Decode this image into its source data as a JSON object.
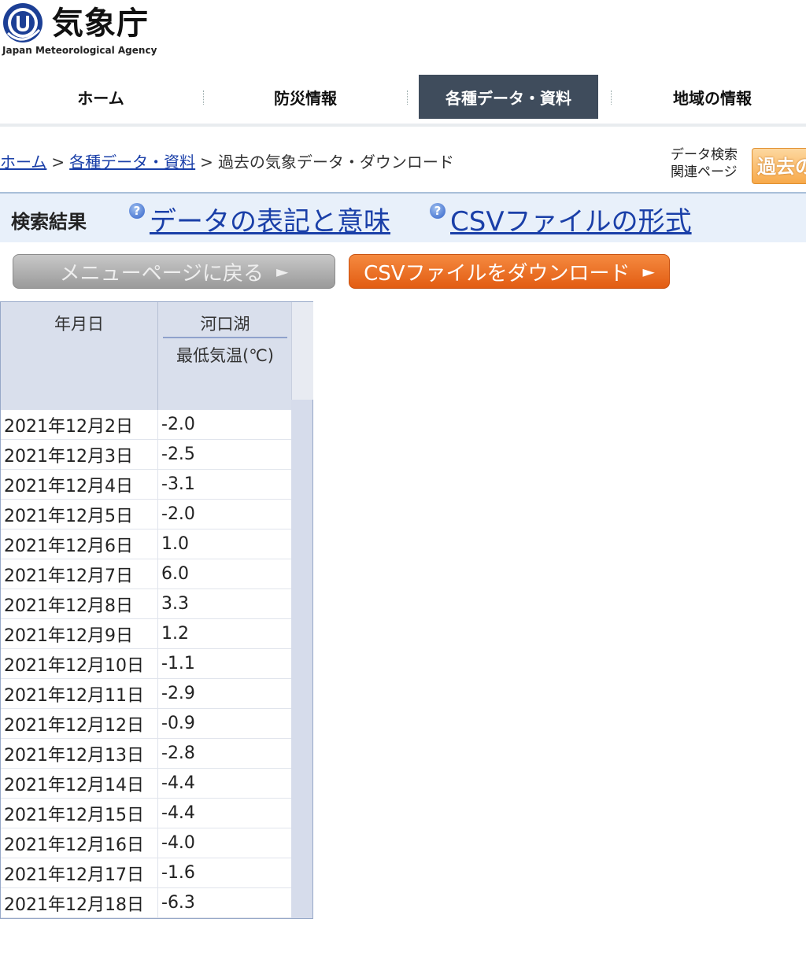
{
  "header": {
    "agency_name": "気象庁",
    "agency_subtitle": "Japan Meteorological Agency"
  },
  "nav": {
    "items": [
      {
        "label": "ホーム"
      },
      {
        "label": "防災情報"
      },
      {
        "label": "各種データ・資料"
      },
      {
        "label": "地域の情報"
      }
    ],
    "active_index": 2
  },
  "breadcrumb": {
    "home": "ホーム",
    "sep": ">",
    "section": "各種データ・資料",
    "current": "過去の気象データ・ダウンロード"
  },
  "related": {
    "label": "データ検索関連ページ",
    "button_label": "過去の"
  },
  "results": {
    "title": "検索結果",
    "link1": "データの表記と意味",
    "link2": "CSVファイルの形式",
    "help_icon": "?"
  },
  "buttons": {
    "back": "メニューページに戻る",
    "csv": "CSVファイルをダウンロード",
    "arrow": "►"
  },
  "table": {
    "date_header": "年月日",
    "station": "河口湖",
    "measure": "最低気温(℃)",
    "rows": [
      {
        "date": "2021年12月2日",
        "value": "-2.0"
      },
      {
        "date": "2021年12月3日",
        "value": "-2.5"
      },
      {
        "date": "2021年12月4日",
        "value": "-3.1"
      },
      {
        "date": "2021年12月5日",
        "value": "-2.0"
      },
      {
        "date": "2021年12月6日",
        "value": "1.0"
      },
      {
        "date": "2021年12月7日",
        "value": "6.0"
      },
      {
        "date": "2021年12月8日",
        "value": "3.3"
      },
      {
        "date": "2021年12月9日",
        "value": "1.2"
      },
      {
        "date": "2021年12月10日",
        "value": "-1.1"
      },
      {
        "date": "2021年12月11日",
        "value": "-2.9"
      },
      {
        "date": "2021年12月12日",
        "value": "-0.9"
      },
      {
        "date": "2021年12月13日",
        "value": "-2.8"
      },
      {
        "date": "2021年12月14日",
        "value": "-4.4"
      },
      {
        "date": "2021年12月15日",
        "value": "-4.4"
      },
      {
        "date": "2021年12月16日",
        "value": "-4.0"
      },
      {
        "date": "2021年12月17日",
        "value": "-1.6"
      },
      {
        "date": "2021年12月18日",
        "value": "-6.3"
      }
    ]
  },
  "colors": {
    "nav_active": "#3f4c5c",
    "link": "#1a3fa8",
    "csv_button": "#e25c12",
    "results_bar": "#e8f0fa"
  }
}
